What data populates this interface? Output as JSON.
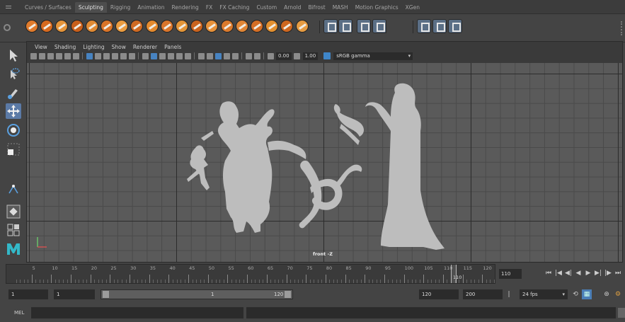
{
  "shelf": {
    "tabs": [
      "Curves / Surfaces",
      "Sculpting",
      "Rigging",
      "Animation",
      "Rendering",
      "FX",
      "FX Caching",
      "Custom",
      "Arnold",
      "Bifrost",
      "MASH",
      "Motion Graphics",
      "XGen"
    ],
    "active_tab": "Sculpting",
    "tool_colors": [
      "#e07b2c",
      "#d66a1f",
      "#e4943a",
      "#c85f1b",
      "#e08a34",
      "#d97428",
      "#eb9c40",
      "#cf6a22",
      "#e48a2e",
      "#d9752b",
      "#e39538",
      "#c9631e",
      "#e6913a",
      "#da7a2d",
      "#e08636",
      "#d46e25",
      "#e29030",
      "#cd6720",
      "#e59b42"
    ]
  },
  "viewport": {
    "menus": [
      "View",
      "Shading",
      "Lighting",
      "Show",
      "Renderer",
      "Panels"
    ],
    "exposure_value": "0.00",
    "gamma_value": "1.00",
    "color_space": "sRGB gamma",
    "camera_label": "front -Z"
  },
  "timeline": {
    "ticks": [
      5,
      10,
      15,
      20,
      25,
      30,
      35,
      40,
      45,
      50,
      55,
      60,
      65,
      70,
      75,
      80,
      85,
      90,
      95,
      100,
      105,
      110,
      115,
      120
    ],
    "current_frame_marker": "110",
    "current_frame_field": "110"
  },
  "range": {
    "start_frame": "1",
    "playback_start": "1",
    "range_start_label": "1",
    "range_end_label": "120",
    "playback_end": "120",
    "end_frame": "200",
    "fps": "24 fps"
  },
  "command_line": {
    "label": "MEL"
  }
}
